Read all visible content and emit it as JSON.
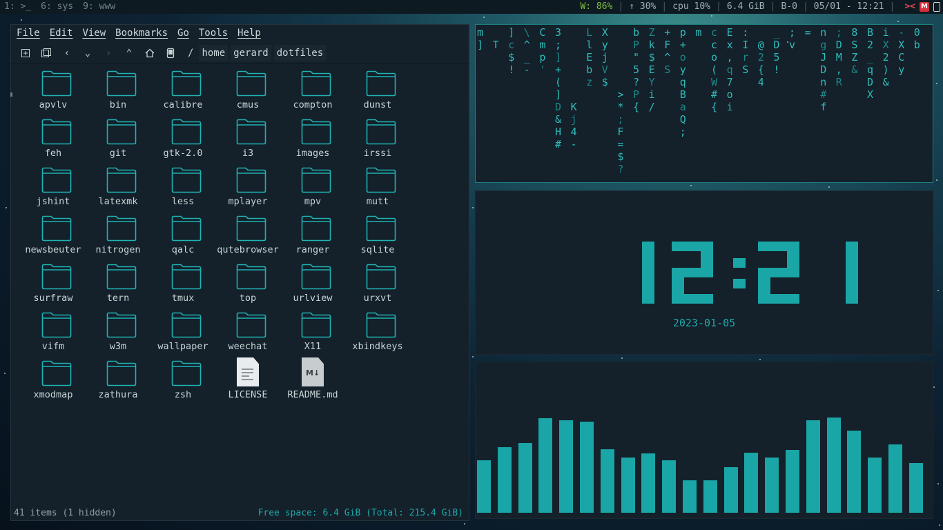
{
  "topbar": {
    "workspaces": [
      {
        "label": "1: >_"
      },
      {
        "label": "6: sys"
      },
      {
        "label": "9: www"
      }
    ],
    "wifi": "W: 86%",
    "brightness": "↑ 30%",
    "cpu": "cpu 10%",
    "mem": "6.4 GiB",
    "battery": "B-0",
    "datetime": "05/01 - 12:21",
    "mail_badge": "M"
  },
  "file_manager": {
    "menu": [
      "File",
      "Edit",
      "View",
      "Bookmarks",
      "Go",
      "Tools",
      "Help"
    ],
    "breadcrumb": [
      "/",
      "home",
      "gerard",
      "dotfiles"
    ],
    "items": [
      {
        "name": "apvlv",
        "type": "folder"
      },
      {
        "name": "bin",
        "type": "folder"
      },
      {
        "name": "calibre",
        "type": "folder"
      },
      {
        "name": "cmus",
        "type": "folder"
      },
      {
        "name": "compton",
        "type": "folder"
      },
      {
        "name": "dunst",
        "type": "folder"
      },
      {
        "name": "feh",
        "type": "folder"
      },
      {
        "name": "git",
        "type": "folder"
      },
      {
        "name": "gtk-2.0",
        "type": "folder"
      },
      {
        "name": "i3",
        "type": "folder"
      },
      {
        "name": "images",
        "type": "folder"
      },
      {
        "name": "irssi",
        "type": "folder"
      },
      {
        "name": "jshint",
        "type": "folder"
      },
      {
        "name": "latexmk",
        "type": "folder"
      },
      {
        "name": "less",
        "type": "folder"
      },
      {
        "name": "mplayer",
        "type": "folder"
      },
      {
        "name": "mpv",
        "type": "folder"
      },
      {
        "name": "mutt",
        "type": "folder"
      },
      {
        "name": "newsbeuter",
        "type": "folder"
      },
      {
        "name": "nitrogen",
        "type": "folder"
      },
      {
        "name": "qalc",
        "type": "folder"
      },
      {
        "name": "qutebrowser",
        "type": "folder"
      },
      {
        "name": "ranger",
        "type": "folder"
      },
      {
        "name": "sqlite",
        "type": "folder"
      },
      {
        "name": "surfraw",
        "type": "folder"
      },
      {
        "name": "tern",
        "type": "folder"
      },
      {
        "name": "tmux",
        "type": "folder"
      },
      {
        "name": "top",
        "type": "folder"
      },
      {
        "name": "urlview",
        "type": "folder"
      },
      {
        "name": "urxvt",
        "type": "folder"
      },
      {
        "name": "vifm",
        "type": "folder"
      },
      {
        "name": "w3m",
        "type": "folder"
      },
      {
        "name": "wallpaper",
        "type": "folder"
      },
      {
        "name": "weechat",
        "type": "folder"
      },
      {
        "name": "X11",
        "type": "folder"
      },
      {
        "name": "xbindkeys",
        "type": "folder"
      },
      {
        "name": "xmodmap",
        "type": "folder"
      },
      {
        "name": "zathura",
        "type": "folder"
      },
      {
        "name": "zsh",
        "type": "folder"
      },
      {
        "name": "LICENSE",
        "type": "text"
      },
      {
        "name": "README.md",
        "type": "markdown"
      }
    ],
    "status_left": "41 items (1 hidden)",
    "status_right": "Free space: 6.4 GiB (Total: 215.4 GiB)"
  },
  "matrix": {
    "columns": [
      {
        "chars": "m]"
      },
      {
        "chars": "T"
      },
      {
        "chars": "]c$!"
      },
      {
        "chars": "\\^_-"
      },
      {
        "chars": "Cmp'"
      },
      {
        "chars": "3;]+(]D&H#"
      },
      {
        "chars": "Kj4-"
      },
      {
        "chars": "LlEbz"
      },
      {
        "chars": "XyjV$"
      },
      {
        "chars": ">*;F=$?"
      },
      {
        "chars": "bP\"5?P{"
      },
      {
        "chars": "Zk$EYi/"
      },
      {
        "chars": "+F^S"
      },
      {
        "chars": "p+oyqBaQ;"
      },
      {
        "chars": "m"
      },
      {
        "chars": "cco(W#{"
      },
      {
        "chars": "Ex,q7oi"
      },
      {
        "chars": ":IrS"
      },
      {
        "chars": "@2{4"
      },
      {
        "chars": "_D5!"
      },
      {
        "chars": ";v"
      },
      {
        "chars": "="
      },
      {
        "chars": "ngJDn#f"
      },
      {
        "chars": ";DM,R"
      },
      {
        "chars": "8SZ&"
      },
      {
        "chars": "B2_qDX"
      },
      {
        "chars": "iX2)&"
      },
      {
        "chars": "-XCy"
      },
      {
        "chars": "0b"
      }
    ]
  },
  "clock": {
    "time": "12:21",
    "date": "2023-01-05"
  },
  "visualizer": {
    "levels": [
      0.55,
      0.69,
      0.73,
      0.99,
      0.97,
      0.96,
      0.67,
      0.58,
      0.62,
      0.55,
      0.34,
      0.34,
      0.48,
      0.63,
      0.58,
      0.66,
      0.97,
      1.0,
      0.86,
      0.58,
      0.72,
      0.52
    ],
    "color": "#1aa6a6"
  },
  "colors": {
    "accent": "#1aa6a6",
    "wifi": "#7dbf3a",
    "mail": "#d6303c",
    "pane_bg": "#14202a"
  }
}
